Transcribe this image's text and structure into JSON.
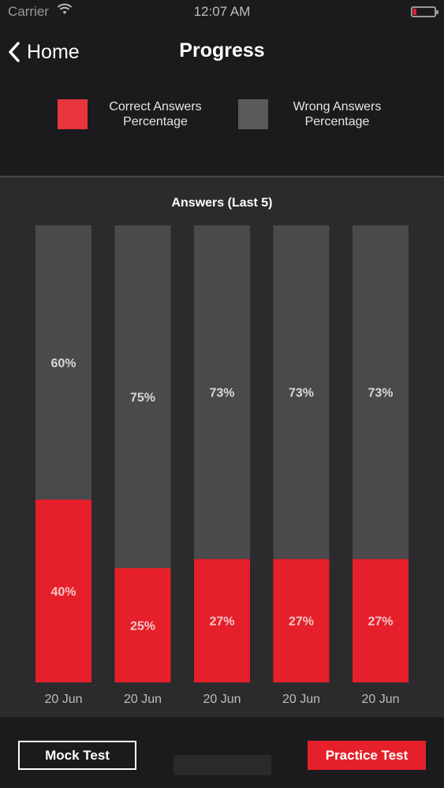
{
  "status_bar": {
    "carrier": "Carrier",
    "time": "12:07 AM"
  },
  "nav": {
    "back_label": "Home",
    "title": "Progress"
  },
  "legend": {
    "correct_label": "Correct Answers Percentage",
    "wrong_label": "Wrong Answers Percentage",
    "correct_color": "#e8343c",
    "wrong_color": "#5a595c"
  },
  "chart_data": {
    "type": "bar",
    "title": "Answers (Last 5)",
    "categories": [
      "20 Jun",
      "20 Jun",
      "20 Jun",
      "20 Jun",
      "20 Jun"
    ],
    "series": [
      {
        "name": "Correct Answers Percentage",
        "values": [
          40,
          25,
          27,
          27,
          27
        ],
        "color": "#e5202b",
        "labels": [
          "40%",
          "25%",
          "27%",
          "27%",
          "27%"
        ]
      },
      {
        "name": "Wrong Answers Percentage",
        "values": [
          60,
          75,
          73,
          73,
          73
        ],
        "color": "#4a494c",
        "labels": [
          "60%",
          "75%",
          "73%",
          "73%",
          "73%"
        ]
      }
    ],
    "stacked": true,
    "ylim": [
      0,
      100
    ],
    "grid": false,
    "legend": "top"
  },
  "footer": {
    "mock_label": "Mock Test",
    "practice_label": "Practice Test"
  }
}
